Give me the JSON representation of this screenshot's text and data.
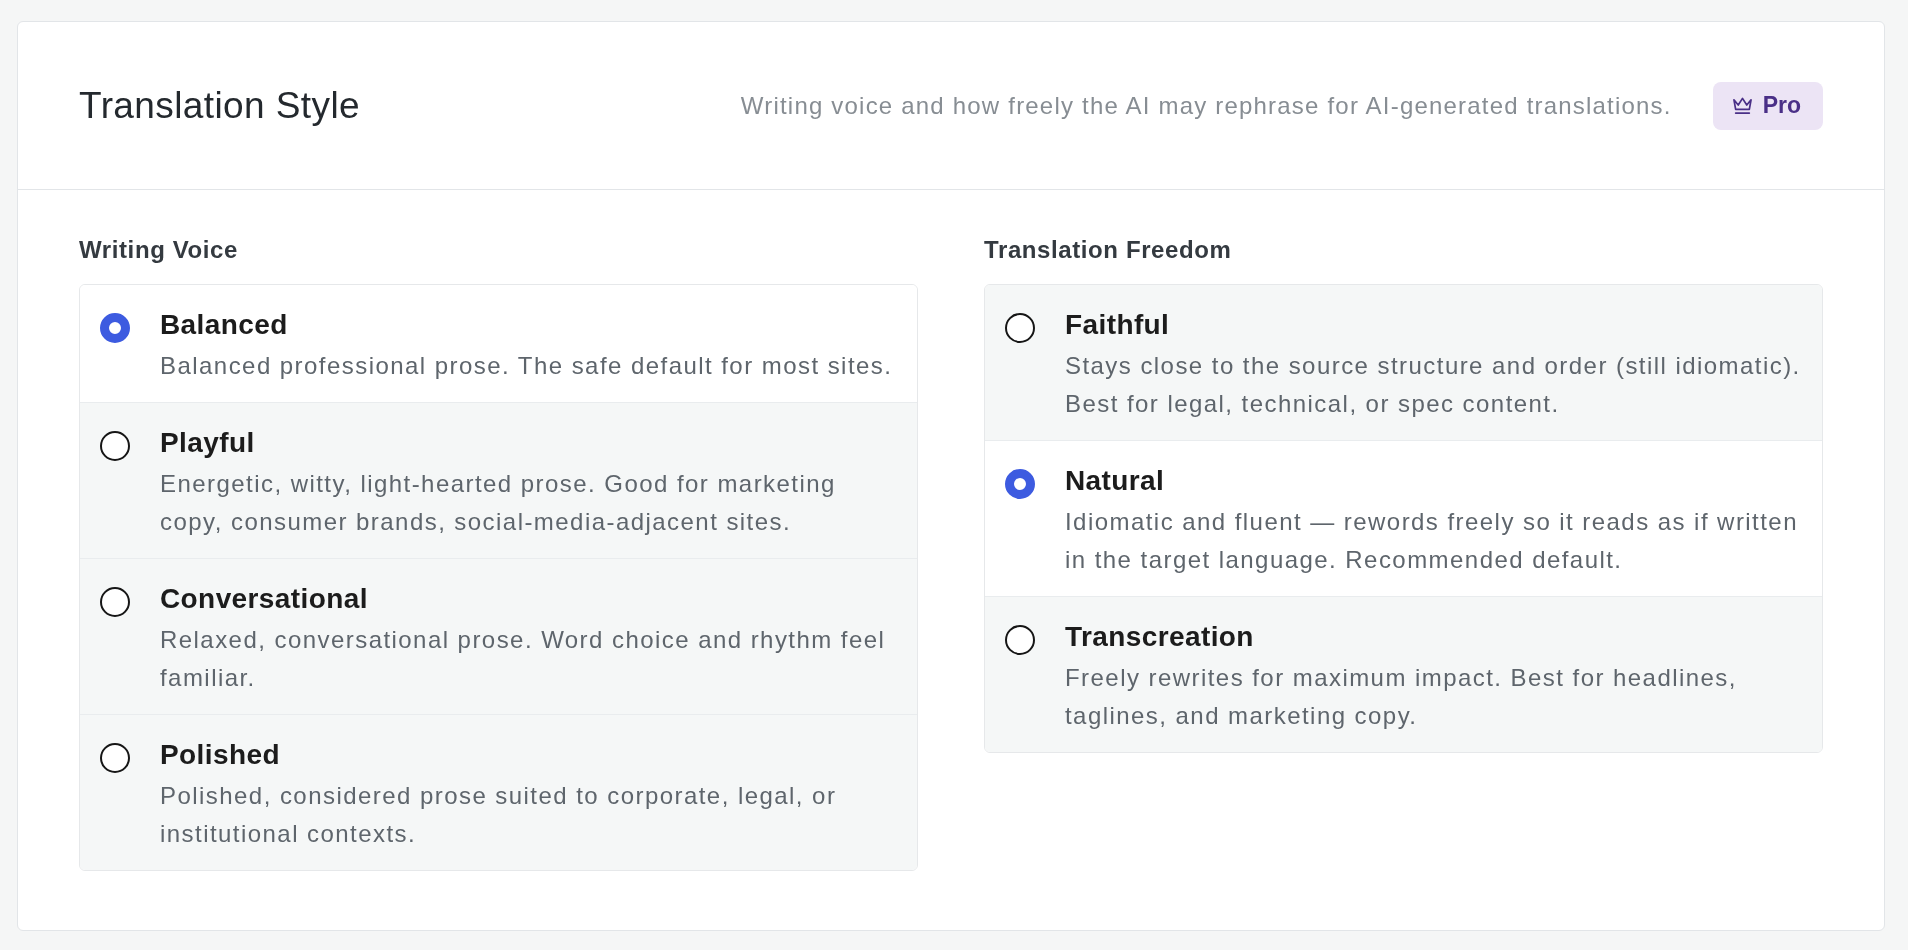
{
  "card": {
    "title": "Translation Style",
    "description": "Writing voice and how freely the AI may rephrase for AI-generated translations.",
    "badge": {
      "label": "Pro"
    }
  },
  "groups": [
    {
      "heading": "Writing Voice",
      "options": [
        {
          "label": "Balanced",
          "description": "Balanced professional prose. The safe default for most sites.",
          "selected": true
        },
        {
          "label": "Playful",
          "description": "Energetic, witty, light-hearted prose. Good for marketing copy, consumer brands, social-media-adjacent sites.",
          "selected": false
        },
        {
          "label": "Conversational",
          "description": "Relaxed, conversational prose. Word choice and rhythm feel familiar.",
          "selected": false
        },
        {
          "label": "Polished",
          "description": "Polished, considered prose suited to corporate, legal, or institutional contexts.",
          "selected": false
        }
      ]
    },
    {
      "heading": "Translation Freedom",
      "options": [
        {
          "label": "Faithful",
          "description": "Stays close to the source structure and order (still idiomatic). Best for legal, technical, or spec content.",
          "selected": false
        },
        {
          "label": "Natural",
          "description": "Idiomatic and fluent — rewords freely so it reads as if written in the target language. Recommended default.",
          "selected": true
        },
        {
          "label": "Transcreation",
          "description": "Freely rewrites for maximum impact. Best for headlines, taglines, and marketing copy.",
          "selected": false
        }
      ]
    }
  ]
}
